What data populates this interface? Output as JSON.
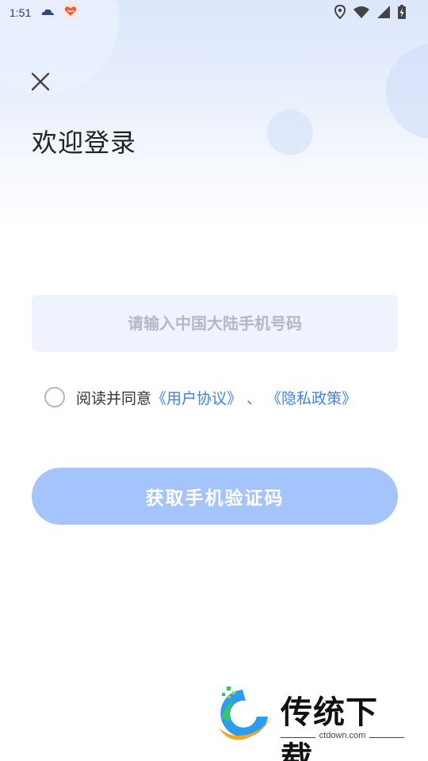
{
  "status_bar": {
    "time": "1:51",
    "icons": [
      "cloud-icon",
      "app-heart-icon",
      "location-icon",
      "wifi-icon",
      "signal-icon",
      "battery-charging-icon"
    ]
  },
  "header": {
    "close_icon": "close-icon",
    "title": "欢迎登录"
  },
  "form": {
    "phone_placeholder": "请输入中国大陆手机号码",
    "phone_value": "",
    "agreement": {
      "prefix": "阅读并同意",
      "user_agreement": "《用户协议》",
      "separator": "、",
      "privacy_policy": "《隐私政策》",
      "checked": false
    },
    "submit_label": "获取手机验证码"
  },
  "watermark": {
    "brand": "传统下载",
    "url": "ctdown.com"
  },
  "colors": {
    "accent": "#3b82f0",
    "button_disabled": "#a5c4fb",
    "input_bg": "#eef3fd"
  }
}
